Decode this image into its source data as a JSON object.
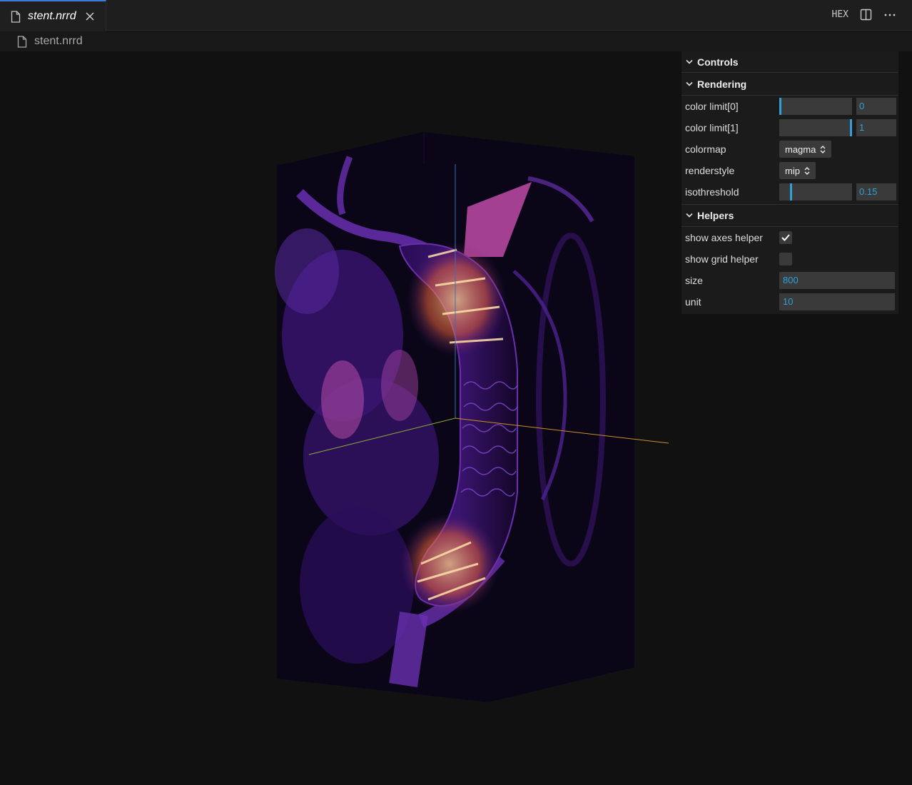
{
  "tab": {
    "label": "stent.nrrd"
  },
  "toolbar": {
    "hex_label": "HEX"
  },
  "breadcrumb": {
    "label": "stent.nrrd"
  },
  "controls": {
    "title": "Controls",
    "rendering": {
      "title": "Rendering",
      "color_limit_0": {
        "label": "color limit[0]",
        "value": "0",
        "fraction": 0.0
      },
      "color_limit_1": {
        "label": "color limit[1]",
        "value": "1",
        "fraction": 1.0
      },
      "colormap": {
        "label": "colormap",
        "value": "magma"
      },
      "renderstyle": {
        "label": "renderstyle",
        "value": "mip"
      },
      "isothreshold": {
        "label": "isothreshold",
        "value": "0.15",
        "fraction": 0.15
      }
    },
    "helpers": {
      "title": "Helpers",
      "show_axes": {
        "label": "show axes helper",
        "checked": true
      },
      "show_grid": {
        "label": "show grid helper",
        "checked": false
      },
      "size": {
        "label": "size",
        "value": "800"
      },
      "unit": {
        "label": "unit",
        "value": "10"
      }
    }
  },
  "colors": {
    "accent": "#2fa1d6",
    "tab_border": "#3c7ad6"
  }
}
